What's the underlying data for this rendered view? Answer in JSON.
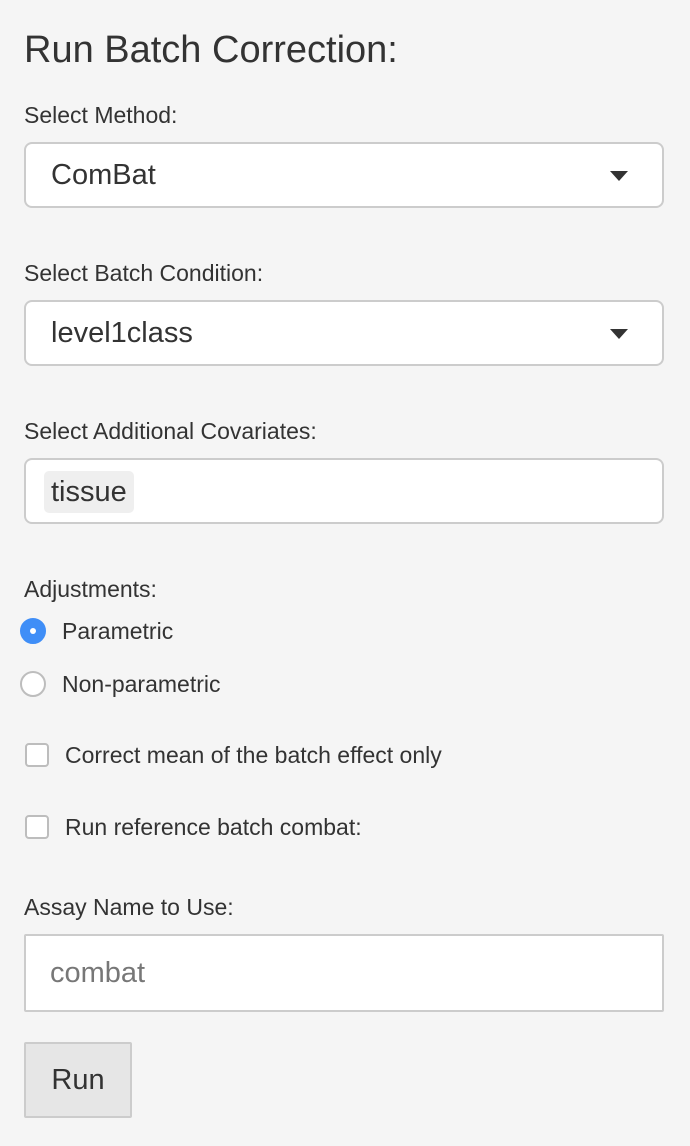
{
  "title": "Run Batch Correction:",
  "method": {
    "label": "Select Method:",
    "value": "ComBat",
    "icon": "chevron-down-icon"
  },
  "batch_condition": {
    "label": "Select Batch Condition:",
    "value": "level1class",
    "icon": "chevron-down-icon"
  },
  "covariates": {
    "label": "Select Additional Covariates:",
    "tags": [
      "tissue"
    ]
  },
  "adjustments": {
    "label": "Adjustments:",
    "options": [
      {
        "label": "Parametric",
        "checked": true
      },
      {
        "label": "Non-parametric",
        "checked": false
      }
    ]
  },
  "checkboxes": {
    "mean_only": {
      "label": "Correct mean of the batch effect only",
      "checked": false
    },
    "ref_batch": {
      "label": "Run reference batch combat:",
      "checked": false
    }
  },
  "assay_name": {
    "label": "Assay Name to Use:",
    "value": "",
    "placeholder": "combat"
  },
  "run_button": {
    "label": "Run"
  },
  "colors": {
    "background": "#f5f5f5",
    "accent": "#3f8ef7",
    "border": "#cccccc",
    "button_bg": "#e6e6e6"
  }
}
